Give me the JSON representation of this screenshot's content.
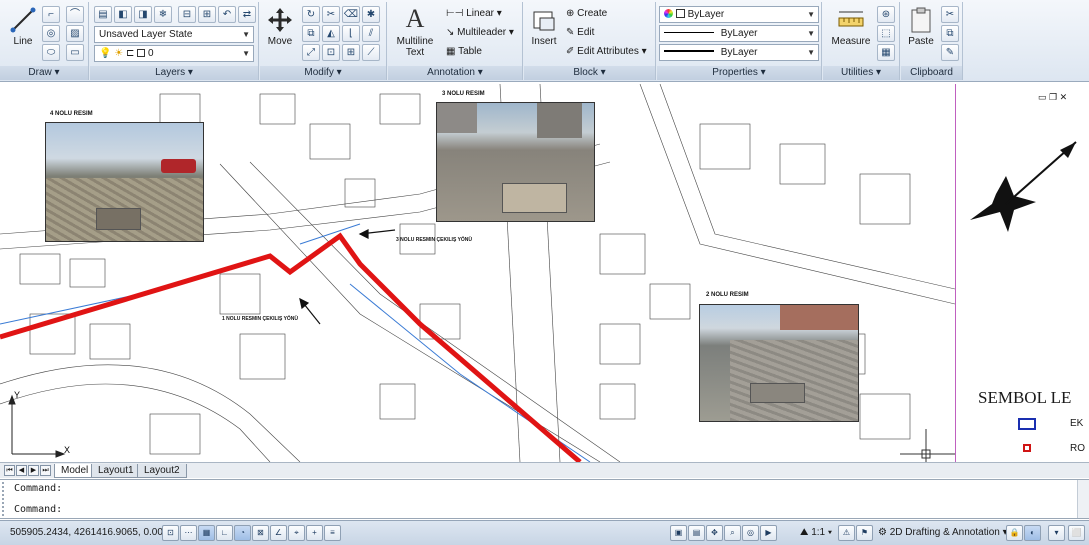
{
  "ribbon": {
    "panels": [
      {
        "title": "Draw"
      },
      {
        "title": "Layers"
      },
      {
        "title": "Modify"
      },
      {
        "title": "Annotation"
      },
      {
        "title": "Block"
      },
      {
        "title": "Properties"
      },
      {
        "title": "Utilities"
      },
      {
        "title": "Clipboard"
      }
    ],
    "draw": {
      "line_label": "Line"
    },
    "layers": {
      "layer_state": "Unsaved Layer State",
      "current_layer": "0"
    },
    "modify": {
      "move_label": "Move"
    },
    "annotation": {
      "multiline_text_label": "Multiline Text",
      "linear_label": "Linear",
      "multileader_label": "Multileader",
      "table_label": "Table"
    },
    "block": {
      "insert_label": "Insert",
      "create_label": "Create",
      "edit_label": "Edit",
      "edit_attributes_label": "Edit Attributes"
    },
    "properties": {
      "color": "ByLayer",
      "linetype": "ByLayer",
      "lineweight": "ByLayer"
    },
    "utilities": {
      "measure_label": "Measure"
    },
    "clipboard": {
      "paste_label": "Paste"
    }
  },
  "drawing": {
    "photos": [
      {
        "label": "4 NOLU RESIM"
      },
      {
        "label": "3 NOLU RESIM"
      },
      {
        "label": "2 NOLU RESIM"
      }
    ],
    "notes": [
      {
        "text": "3 NOLU RESMIN ÇEKILIŞ YÖNÜ"
      },
      {
        "text": "1 NOLU RESMIN ÇEKILIŞ YÖNÜ"
      }
    ],
    "ucs": {
      "x": "X",
      "y": "Y"
    },
    "route_color": "#e01414"
  },
  "legend": {
    "title": "SEMBOL LE",
    "items": [
      {
        "text": "EK",
        "color": "#1a2fb0"
      },
      {
        "text": "RO",
        "color": "#d01414"
      }
    ]
  },
  "tabs": [
    {
      "label": "Model"
    },
    {
      "label": "Layout1"
    },
    {
      "label": "Layout2"
    }
  ],
  "command": {
    "history": "Command:",
    "prompt": "Command:"
  },
  "status": {
    "coordinates": "505905.2434, 4261416.9065, 0.0000",
    "annotation_scale": "1:1",
    "workspace": "2D Drafting & Annotation"
  }
}
